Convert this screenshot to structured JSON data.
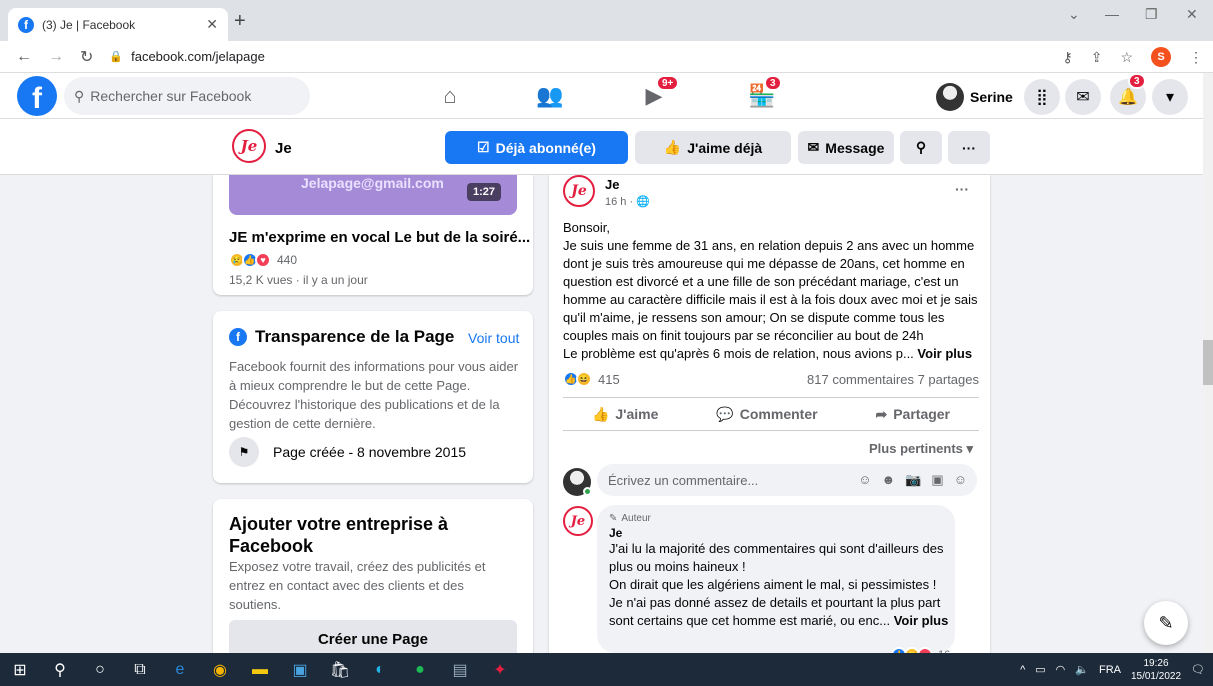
{
  "browser": {
    "tab_title": "(3) Je | Facebook",
    "url": "facebook.com/jelapage",
    "profile_initial": "S"
  },
  "fb_nav": {
    "search_placeholder": "Rechercher sur Facebook",
    "watch_badge": "9+",
    "marketplace_badge": "3",
    "notifications_badge": "3",
    "user_name": "Serine"
  },
  "page_bar": {
    "title": "Je",
    "subscribed_label": "Déjà abonné(e)",
    "liked_label": "J'aime déjà",
    "message_label": "Message"
  },
  "video_card": {
    "thumb_email": "Jelapage@gmail.com",
    "duration": "1:27",
    "title": "JE m'exprime en vocal Le but de la soiré...",
    "reaction_count": "440",
    "meta": "15,2 K vues · il y a un jour"
  },
  "transparency": {
    "title": "Transparence de la Page",
    "see_all": "Voir tout",
    "text": "Facebook fournit des informations pour vous aider à mieux comprendre le but de cette Page. Découvrez l'historique des publications et de la gestion de cette dernière.",
    "created": "Page créée - 8 novembre 2015"
  },
  "business": {
    "title": "Ajouter votre entreprise à Facebook",
    "text": "Exposez votre travail, créez des publicités et entrez en contact avec des clients et des soutiens.",
    "button": "Créer une Page"
  },
  "post": {
    "author": "Je",
    "time": "16 h · ",
    "body": "Bonsoir,\nJe suis une femme de 31 ans, en relation depuis 2 ans avec un homme dont je suis très amoureuse qui me dépasse de 20ans, cet homme en question est divorcé et a une fille de son précédant mariage, c'est un homme au caractère difficile mais il est à la fois doux avec moi et je sais qu'il m'aime, je ressens son amour; On se dispute comme tous les couples mais on finit toujours par se réconcilier au bout de 24h\nLe problème est qu'après 6 mois de relation, nous avions p... ",
    "see_more": "Voir plus",
    "reaction_count": "415",
    "comments_shares": "817 commentaires 7 partages",
    "like": "J'aime",
    "comment": "Commenter",
    "share": "Partager",
    "sort": "Plus pertinents",
    "comment_placeholder": "Écrivez un commentaire..."
  },
  "reply": {
    "badge": "Auteur",
    "name": "Je",
    "text": "J'ai lu la majorité des commentaires qui sont d'ailleurs des plus ou moins haineux !\nOn dirait que les algériens aiment le mal, si pessimistes !\nJe n'ai pas donné assez de details et pourtant la plus part sont certains que cet homme est marié, ou enc... ",
    "see_more": "Voir plus",
    "reaction_count": "16"
  },
  "taskbar": {
    "lang": "FRA",
    "time": "19:26",
    "date": "15/01/2022"
  },
  "colors": {
    "fb_blue": "#1877f2",
    "badge_red": "#e41e3f"
  }
}
